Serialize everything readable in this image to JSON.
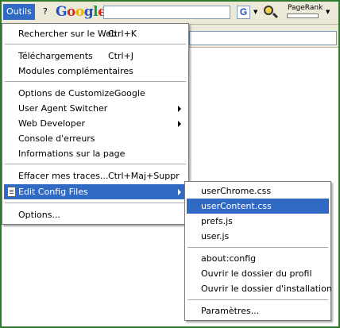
{
  "menubar": {
    "outils_label": "Outils",
    "help_label": "?",
    "google_logo": "Google",
    "search_button_glyph": "G",
    "pagerank_label": "PageRank",
    "pagerank_level": 0
  },
  "tools_menu": {
    "items": [
      {
        "label": "Rechercher sur le Web",
        "shortcut": "Ctrl+K"
      },
      {
        "label": "Téléchargements",
        "shortcut": "Ctrl+J"
      },
      {
        "label": "Modules complémentaires",
        "shortcut": ""
      },
      {
        "label": "Options de CustomizeGoogle",
        "shortcut": ""
      },
      {
        "label": "User Agent Switcher",
        "shortcut": ""
      },
      {
        "label": "Web Developer",
        "shortcut": ""
      },
      {
        "label": "Console d'erreurs",
        "shortcut": ""
      },
      {
        "label": "Informations sur la page",
        "shortcut": ""
      },
      {
        "label": "Effacer mes traces...",
        "shortcut": "Ctrl+Maj+Suppr"
      },
      {
        "label": "Edit Config Files",
        "shortcut": ""
      },
      {
        "label": "Options...",
        "shortcut": ""
      }
    ]
  },
  "config_submenu": {
    "items": [
      {
        "label": "userChrome.css"
      },
      {
        "label": "userContent.css"
      },
      {
        "label": "prefs.js"
      },
      {
        "label": "user.js"
      },
      {
        "label": "about:config"
      },
      {
        "label": "Ouvrir le dossier du profil"
      },
      {
        "label": "Ouvrir le dossier d'installation"
      },
      {
        "label": "Paramètres..."
      }
    ]
  },
  "colors": {
    "highlight": "#316ac5",
    "frame_border": "#2d7a2d",
    "google_blue": "#2250c5",
    "google_red": "#d62d20",
    "google_yellow": "#e8b100",
    "google_green": "#1a9b3c"
  },
  "icons": {
    "search_engine": "google-g-icon",
    "highlighter": "highlighter-icon",
    "edit_config": "document-icon"
  }
}
